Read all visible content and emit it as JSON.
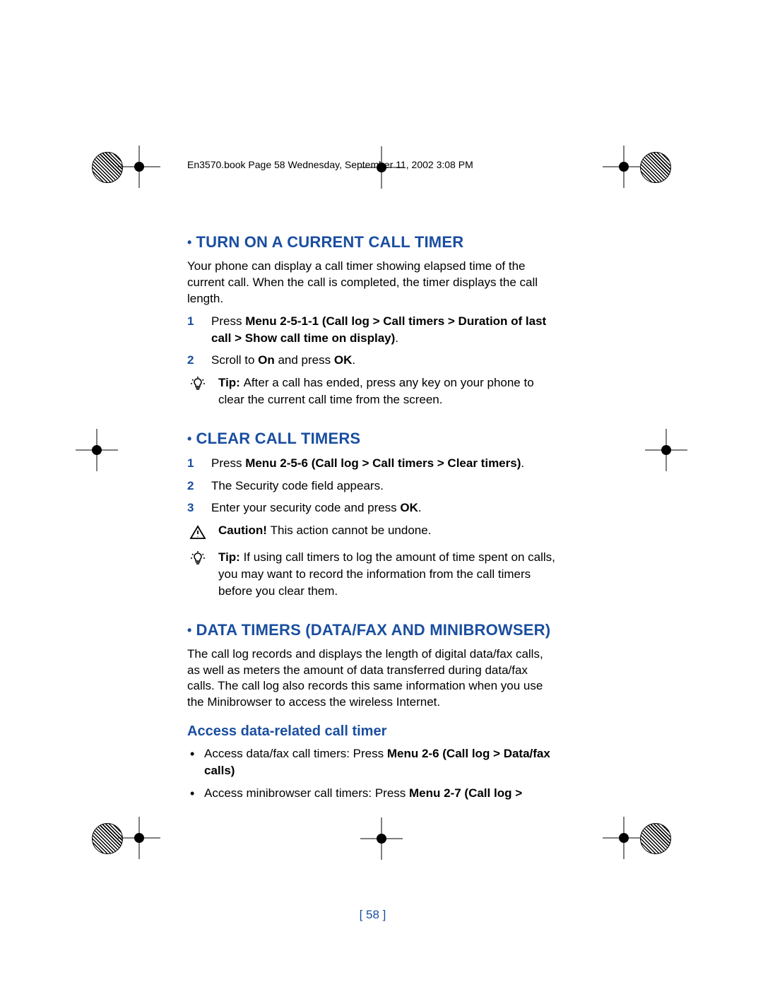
{
  "header": {
    "meta": "En3570.book  Page 58  Wednesday, September 11, 2002  3:08 PM"
  },
  "sections": {
    "s1": {
      "title": "TURN ON A CURRENT CALL TIMER",
      "intro": "Your phone can display a call timer showing elapsed time of the current call. When the call is completed, the timer displays the call length.",
      "step1_pre": "Press ",
      "step1_bold": "Menu 2-5-1-1 (Call log > Call timers > Duration of last call > Show call time on display)",
      "step1_post": ".",
      "step2_pre": "Scroll to ",
      "step2_b1": "On",
      "step2_mid": " and press ",
      "step2_b2": "OK",
      "step2_post": ".",
      "tip_label": "Tip: ",
      "tip_text": "After a call has ended, press any key on your phone to clear the current call time from the screen."
    },
    "s2": {
      "title": "CLEAR CALL TIMERS",
      "step1_pre": "Press ",
      "step1_bold": "Menu 2-5-6 (Call log > Call timers > Clear timers)",
      "step1_post": ".",
      "step2": "The Security code field appears.",
      "step3_pre": "Enter your security code and press ",
      "step3_bold": "OK",
      "step3_post": ".",
      "caution_label": "Caution! ",
      "caution_text": "This action cannot be undone.",
      "tip_label": "Tip: ",
      "tip_text": "If using call timers to log the amount of time spent on calls, you may want to record the information from the call timers before you clear them."
    },
    "s3": {
      "title": "DATA TIMERS (DATA/FAX AND MINIBROWSER)",
      "intro": "The call log records and displays the length of digital data/fax calls, as well as meters the amount of data transferred during data/fax calls. The call log also records this same information when you use the Minibrowser to access the wireless Internet.",
      "sub_title": "Access data-related call timer",
      "b1_pre": "Access data/fax call timers: Press ",
      "b1_bold": "Menu 2-6 (Call log > Data/fax calls)",
      "b2_pre": "Access minibrowser call timers: Press ",
      "b2_bold": "Menu 2-7 (Call log >"
    }
  },
  "page_number": "[ 58 ]"
}
